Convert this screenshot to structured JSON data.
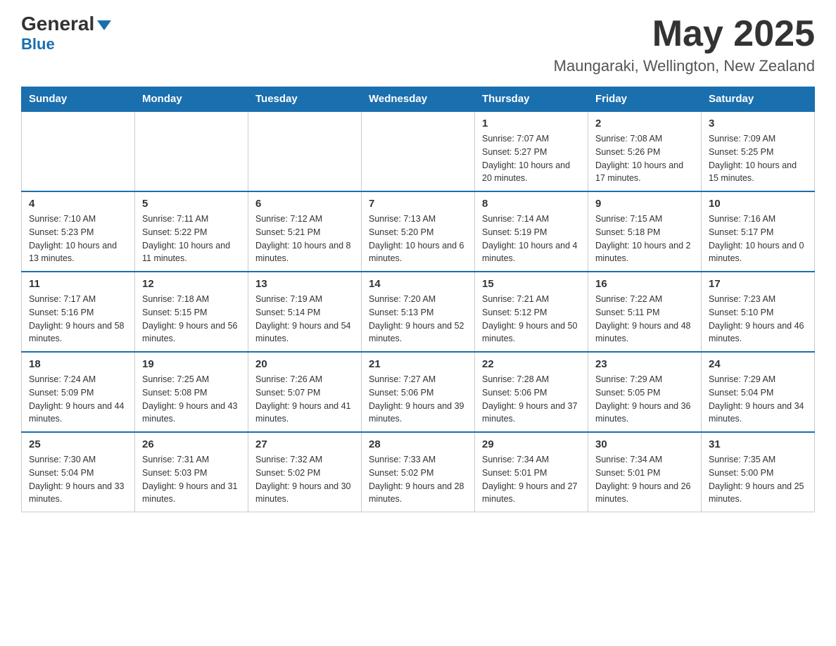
{
  "header": {
    "logo_main": "General",
    "logo_sub": "Blue",
    "month_title": "May 2025",
    "location": "Maungaraki, Wellington, New Zealand"
  },
  "weekdays": [
    "Sunday",
    "Monday",
    "Tuesday",
    "Wednesday",
    "Thursday",
    "Friday",
    "Saturday"
  ],
  "weeks": [
    {
      "days": [
        {
          "number": "",
          "info": ""
        },
        {
          "number": "",
          "info": ""
        },
        {
          "number": "",
          "info": ""
        },
        {
          "number": "",
          "info": ""
        },
        {
          "number": "1",
          "info": "Sunrise: 7:07 AM\nSunset: 5:27 PM\nDaylight: 10 hours and 20 minutes."
        },
        {
          "number": "2",
          "info": "Sunrise: 7:08 AM\nSunset: 5:26 PM\nDaylight: 10 hours and 17 minutes."
        },
        {
          "number": "3",
          "info": "Sunrise: 7:09 AM\nSunset: 5:25 PM\nDaylight: 10 hours and 15 minutes."
        }
      ]
    },
    {
      "days": [
        {
          "number": "4",
          "info": "Sunrise: 7:10 AM\nSunset: 5:23 PM\nDaylight: 10 hours and 13 minutes."
        },
        {
          "number": "5",
          "info": "Sunrise: 7:11 AM\nSunset: 5:22 PM\nDaylight: 10 hours and 11 minutes."
        },
        {
          "number": "6",
          "info": "Sunrise: 7:12 AM\nSunset: 5:21 PM\nDaylight: 10 hours and 8 minutes."
        },
        {
          "number": "7",
          "info": "Sunrise: 7:13 AM\nSunset: 5:20 PM\nDaylight: 10 hours and 6 minutes."
        },
        {
          "number": "8",
          "info": "Sunrise: 7:14 AM\nSunset: 5:19 PM\nDaylight: 10 hours and 4 minutes."
        },
        {
          "number": "9",
          "info": "Sunrise: 7:15 AM\nSunset: 5:18 PM\nDaylight: 10 hours and 2 minutes."
        },
        {
          "number": "10",
          "info": "Sunrise: 7:16 AM\nSunset: 5:17 PM\nDaylight: 10 hours and 0 minutes."
        }
      ]
    },
    {
      "days": [
        {
          "number": "11",
          "info": "Sunrise: 7:17 AM\nSunset: 5:16 PM\nDaylight: 9 hours and 58 minutes."
        },
        {
          "number": "12",
          "info": "Sunrise: 7:18 AM\nSunset: 5:15 PM\nDaylight: 9 hours and 56 minutes."
        },
        {
          "number": "13",
          "info": "Sunrise: 7:19 AM\nSunset: 5:14 PM\nDaylight: 9 hours and 54 minutes."
        },
        {
          "number": "14",
          "info": "Sunrise: 7:20 AM\nSunset: 5:13 PM\nDaylight: 9 hours and 52 minutes."
        },
        {
          "number": "15",
          "info": "Sunrise: 7:21 AM\nSunset: 5:12 PM\nDaylight: 9 hours and 50 minutes."
        },
        {
          "number": "16",
          "info": "Sunrise: 7:22 AM\nSunset: 5:11 PM\nDaylight: 9 hours and 48 minutes."
        },
        {
          "number": "17",
          "info": "Sunrise: 7:23 AM\nSunset: 5:10 PM\nDaylight: 9 hours and 46 minutes."
        }
      ]
    },
    {
      "days": [
        {
          "number": "18",
          "info": "Sunrise: 7:24 AM\nSunset: 5:09 PM\nDaylight: 9 hours and 44 minutes."
        },
        {
          "number": "19",
          "info": "Sunrise: 7:25 AM\nSunset: 5:08 PM\nDaylight: 9 hours and 43 minutes."
        },
        {
          "number": "20",
          "info": "Sunrise: 7:26 AM\nSunset: 5:07 PM\nDaylight: 9 hours and 41 minutes."
        },
        {
          "number": "21",
          "info": "Sunrise: 7:27 AM\nSunset: 5:06 PM\nDaylight: 9 hours and 39 minutes."
        },
        {
          "number": "22",
          "info": "Sunrise: 7:28 AM\nSunset: 5:06 PM\nDaylight: 9 hours and 37 minutes."
        },
        {
          "number": "23",
          "info": "Sunrise: 7:29 AM\nSunset: 5:05 PM\nDaylight: 9 hours and 36 minutes."
        },
        {
          "number": "24",
          "info": "Sunrise: 7:29 AM\nSunset: 5:04 PM\nDaylight: 9 hours and 34 minutes."
        }
      ]
    },
    {
      "days": [
        {
          "number": "25",
          "info": "Sunrise: 7:30 AM\nSunset: 5:04 PM\nDaylight: 9 hours and 33 minutes."
        },
        {
          "number": "26",
          "info": "Sunrise: 7:31 AM\nSunset: 5:03 PM\nDaylight: 9 hours and 31 minutes."
        },
        {
          "number": "27",
          "info": "Sunrise: 7:32 AM\nSunset: 5:02 PM\nDaylight: 9 hours and 30 minutes."
        },
        {
          "number": "28",
          "info": "Sunrise: 7:33 AM\nSunset: 5:02 PM\nDaylight: 9 hours and 28 minutes."
        },
        {
          "number": "29",
          "info": "Sunrise: 7:34 AM\nSunset: 5:01 PM\nDaylight: 9 hours and 27 minutes."
        },
        {
          "number": "30",
          "info": "Sunrise: 7:34 AM\nSunset: 5:01 PM\nDaylight: 9 hours and 26 minutes."
        },
        {
          "number": "31",
          "info": "Sunrise: 7:35 AM\nSunset: 5:00 PM\nDaylight: 9 hours and 25 minutes."
        }
      ]
    }
  ]
}
